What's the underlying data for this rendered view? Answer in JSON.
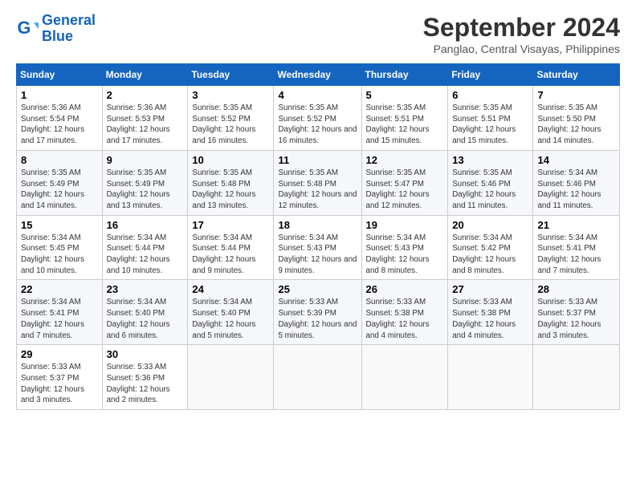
{
  "logo": {
    "line1": "General",
    "line2": "Blue"
  },
  "title": "September 2024",
  "location": "Panglao, Central Visayas, Philippines",
  "headers": [
    "Sunday",
    "Monday",
    "Tuesday",
    "Wednesday",
    "Thursday",
    "Friday",
    "Saturday"
  ],
  "weeks": [
    [
      {
        "day": "1",
        "sunrise": "5:36 AM",
        "sunset": "5:54 PM",
        "daylight": "12 hours and 17 minutes."
      },
      {
        "day": "2",
        "sunrise": "5:36 AM",
        "sunset": "5:53 PM",
        "daylight": "12 hours and 17 minutes."
      },
      {
        "day": "3",
        "sunrise": "5:35 AM",
        "sunset": "5:52 PM",
        "daylight": "12 hours and 16 minutes."
      },
      {
        "day": "4",
        "sunrise": "5:35 AM",
        "sunset": "5:52 PM",
        "daylight": "12 hours and 16 minutes."
      },
      {
        "day": "5",
        "sunrise": "5:35 AM",
        "sunset": "5:51 PM",
        "daylight": "12 hours and 15 minutes."
      },
      {
        "day": "6",
        "sunrise": "5:35 AM",
        "sunset": "5:51 PM",
        "daylight": "12 hours and 15 minutes."
      },
      {
        "day": "7",
        "sunrise": "5:35 AM",
        "sunset": "5:50 PM",
        "daylight": "12 hours and 14 minutes."
      }
    ],
    [
      {
        "day": "8",
        "sunrise": "5:35 AM",
        "sunset": "5:49 PM",
        "daylight": "12 hours and 14 minutes."
      },
      {
        "day": "9",
        "sunrise": "5:35 AM",
        "sunset": "5:49 PM",
        "daylight": "12 hours and 13 minutes."
      },
      {
        "day": "10",
        "sunrise": "5:35 AM",
        "sunset": "5:48 PM",
        "daylight": "12 hours and 13 minutes."
      },
      {
        "day": "11",
        "sunrise": "5:35 AM",
        "sunset": "5:48 PM",
        "daylight": "12 hours and 12 minutes."
      },
      {
        "day": "12",
        "sunrise": "5:35 AM",
        "sunset": "5:47 PM",
        "daylight": "12 hours and 12 minutes."
      },
      {
        "day": "13",
        "sunrise": "5:35 AM",
        "sunset": "5:46 PM",
        "daylight": "12 hours and 11 minutes."
      },
      {
        "day": "14",
        "sunrise": "5:34 AM",
        "sunset": "5:46 PM",
        "daylight": "12 hours and 11 minutes."
      }
    ],
    [
      {
        "day": "15",
        "sunrise": "5:34 AM",
        "sunset": "5:45 PM",
        "daylight": "12 hours and 10 minutes."
      },
      {
        "day": "16",
        "sunrise": "5:34 AM",
        "sunset": "5:44 PM",
        "daylight": "12 hours and 10 minutes."
      },
      {
        "day": "17",
        "sunrise": "5:34 AM",
        "sunset": "5:44 PM",
        "daylight": "12 hours and 9 minutes."
      },
      {
        "day": "18",
        "sunrise": "5:34 AM",
        "sunset": "5:43 PM",
        "daylight": "12 hours and 9 minutes."
      },
      {
        "day": "19",
        "sunrise": "5:34 AM",
        "sunset": "5:43 PM",
        "daylight": "12 hours and 8 minutes."
      },
      {
        "day": "20",
        "sunrise": "5:34 AM",
        "sunset": "5:42 PM",
        "daylight": "12 hours and 8 minutes."
      },
      {
        "day": "21",
        "sunrise": "5:34 AM",
        "sunset": "5:41 PM",
        "daylight": "12 hours and 7 minutes."
      }
    ],
    [
      {
        "day": "22",
        "sunrise": "5:34 AM",
        "sunset": "5:41 PM",
        "daylight": "12 hours and 7 minutes."
      },
      {
        "day": "23",
        "sunrise": "5:34 AM",
        "sunset": "5:40 PM",
        "daylight": "12 hours and 6 minutes."
      },
      {
        "day": "24",
        "sunrise": "5:34 AM",
        "sunset": "5:40 PM",
        "daylight": "12 hours and 5 minutes."
      },
      {
        "day": "25",
        "sunrise": "5:33 AM",
        "sunset": "5:39 PM",
        "daylight": "12 hours and 5 minutes."
      },
      {
        "day": "26",
        "sunrise": "5:33 AM",
        "sunset": "5:38 PM",
        "daylight": "12 hours and 4 minutes."
      },
      {
        "day": "27",
        "sunrise": "5:33 AM",
        "sunset": "5:38 PM",
        "daylight": "12 hours and 4 minutes."
      },
      {
        "day": "28",
        "sunrise": "5:33 AM",
        "sunset": "5:37 PM",
        "daylight": "12 hours and 3 minutes."
      }
    ],
    [
      {
        "day": "29",
        "sunrise": "5:33 AM",
        "sunset": "5:37 PM",
        "daylight": "12 hours and 3 minutes."
      },
      {
        "day": "30",
        "sunrise": "5:33 AM",
        "sunset": "5:36 PM",
        "daylight": "12 hours and 2 minutes."
      },
      null,
      null,
      null,
      null,
      null
    ]
  ]
}
